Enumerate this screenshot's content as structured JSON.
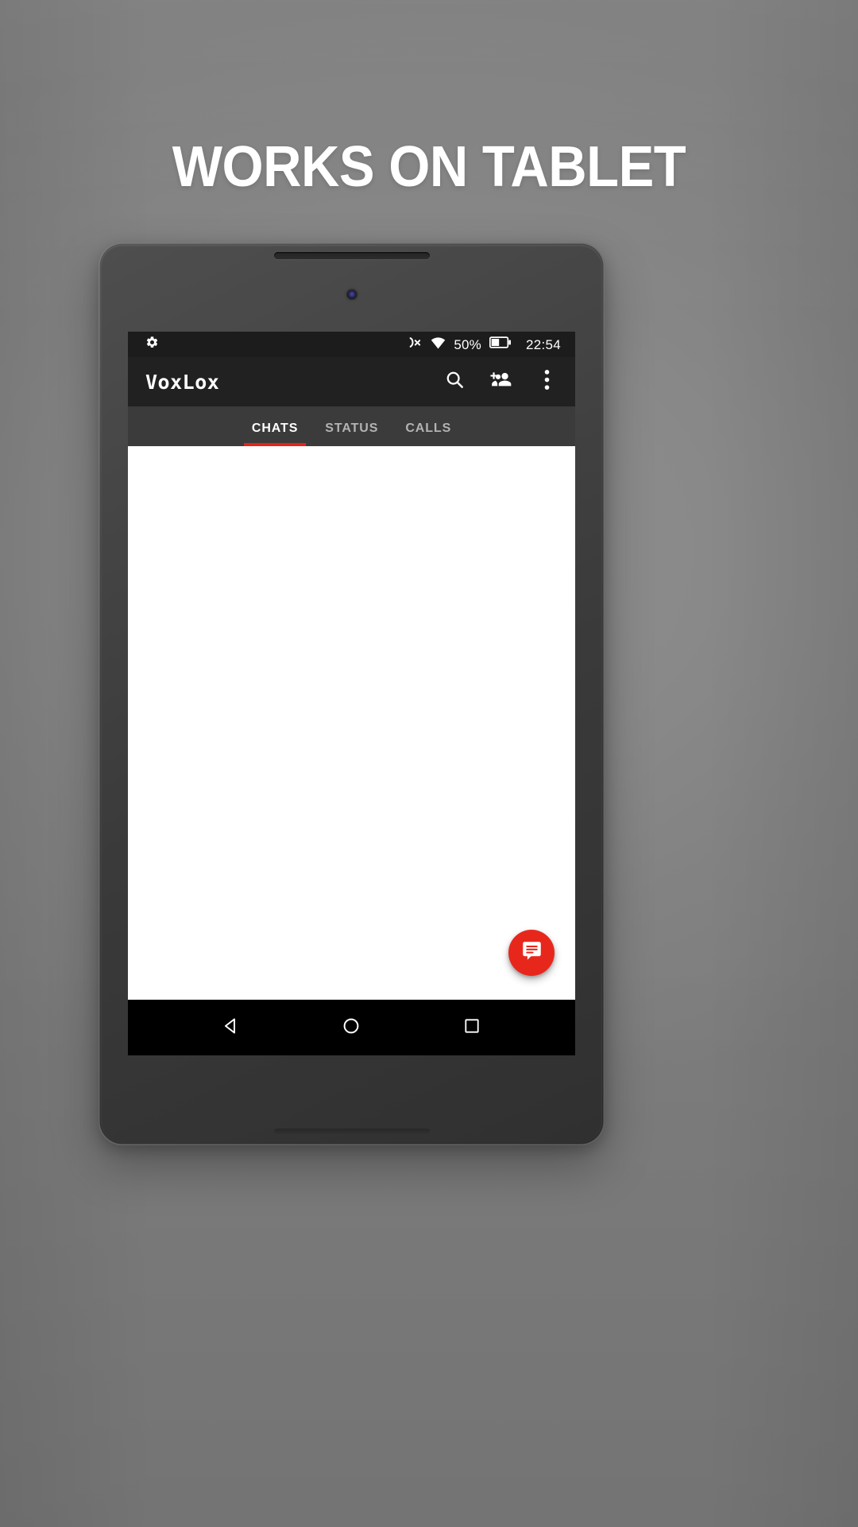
{
  "promo": {
    "headline": "WORKS ON TABLET",
    "background_color": "#858585",
    "headline_color": "#ffffff"
  },
  "device": {
    "type": "android-tablet",
    "body_color": "#3a3a3a",
    "speaker_grille": "speaker-grille",
    "front_camera": "front-camera"
  },
  "screen": {
    "status_bar": {
      "background_color": "#1c1c1c",
      "left_icons": [
        "settings-gear-icon"
      ],
      "right_icons": [
        "mute-vibrate-off-icon",
        "wifi-icon",
        "battery-icon"
      ],
      "battery_percent": "50%",
      "clock": "22:54"
    },
    "app_bar": {
      "title": "VoxLox",
      "background_color": "#212121",
      "actions": [
        {
          "name": "search-button",
          "icon": "search-icon"
        },
        {
          "name": "add-people-button",
          "icon": "person-add-group-icon"
        },
        {
          "name": "overflow-menu-button",
          "icon": "more-vert-icon"
        }
      ]
    },
    "tabs": {
      "background_color": "#3b3b3b",
      "indicator_color": "#e5231a",
      "active_index": 0,
      "items": [
        {
          "label": "CHATS"
        },
        {
          "label": "STATUS"
        },
        {
          "label": "CALLS"
        }
      ]
    },
    "content": {
      "background_color": "#ffffff",
      "empty": true,
      "fab": {
        "name": "new-chat-fab",
        "icon": "chat-bubble-icon",
        "color": "#e8271c"
      }
    },
    "nav_bar": {
      "background_color": "#000000",
      "buttons": [
        {
          "name": "nav-back-button",
          "icon": "back-triangle-icon"
        },
        {
          "name": "nav-home-button",
          "icon": "home-circle-icon"
        },
        {
          "name": "nav-recents-button",
          "icon": "recents-square-icon"
        }
      ]
    }
  }
}
